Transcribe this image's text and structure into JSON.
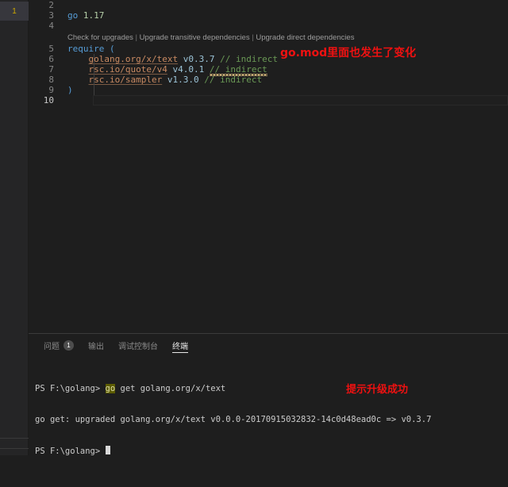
{
  "activity_bar": {
    "marker_count": "1"
  },
  "editor": {
    "lines": [
      {
        "number": "2",
        "type": "code",
        "tokens": []
      },
      {
        "number": "3",
        "type": "code",
        "tokens": [
          {
            "t": "kw",
            "v": "go"
          },
          {
            "t": "plain",
            "v": " "
          },
          {
            "t": "num",
            "v": "1.17"
          }
        ]
      },
      {
        "number": "4",
        "type": "code",
        "tokens": []
      },
      {
        "number": "",
        "type": "codelens",
        "links": [
          "Check for upgrades",
          "Upgrade transitive dependencies",
          "Upgrade direct dependencies"
        ],
        "separator": " | "
      },
      {
        "number": "5",
        "type": "code",
        "tokens": [
          {
            "t": "kw",
            "v": "require"
          },
          {
            "t": "plain",
            "v": " "
          },
          {
            "t": "punct",
            "v": "("
          }
        ]
      },
      {
        "number": "6",
        "type": "code",
        "tokens": [
          {
            "t": "plain",
            "v": "    "
          },
          {
            "t": "path",
            "v": "golang.org/x/text"
          },
          {
            "t": "plain",
            "v": " "
          },
          {
            "t": "ver",
            "v": "v0.3.7"
          },
          {
            "t": "plain",
            "v": " "
          },
          {
            "t": "cmt",
            "v": "// indirect"
          }
        ]
      },
      {
        "number": "7",
        "type": "code",
        "tokens": [
          {
            "t": "plain",
            "v": "    "
          },
          {
            "t": "path",
            "v": "rsc.io/quote/v4"
          },
          {
            "t": "plain",
            "v": " "
          },
          {
            "t": "ver",
            "v": "v4.0.1"
          },
          {
            "t": "plain",
            "v": " "
          },
          {
            "t": "cmt squiggle",
            "v": "// indirect"
          }
        ]
      },
      {
        "number": "8",
        "type": "code",
        "tokens": [
          {
            "t": "plain",
            "v": "    "
          },
          {
            "t": "path",
            "v": "rsc.io/sampler"
          },
          {
            "t": "plain",
            "v": " "
          },
          {
            "t": "ver",
            "v": "v1.3.0"
          },
          {
            "t": "plain",
            "v": " "
          },
          {
            "t": "cmt",
            "v": "// indirect"
          }
        ]
      },
      {
        "number": "9",
        "type": "code",
        "tokens": [
          {
            "t": "punct",
            "v": ")"
          }
        ]
      },
      {
        "number": "10",
        "type": "code",
        "active": true,
        "tokens": []
      }
    ],
    "annotation": "go.mod里面也发生了变化",
    "annotation_color": "#ee1111"
  },
  "panel": {
    "tabs": [
      {
        "label": "问题",
        "badge": "1",
        "active": false
      },
      {
        "label": "输出",
        "badge": "",
        "active": false
      },
      {
        "label": "调试控制台",
        "badge": "",
        "active": false
      },
      {
        "label": "终端",
        "badge": "",
        "active": true
      }
    ],
    "terminal": {
      "line1_prompt": "PS F:\\golang> ",
      "line1_highlight": "go",
      "line1_rest": " get golang.org/x/text",
      "line2": "go get: upgraded golang.org/x/text v0.0.0-20170915032832-14c0d48ead0c => v0.3.7",
      "line3_prompt": "PS F:\\golang> "
    },
    "annotation": "提示升级成功",
    "annotation_color": "#ee1111"
  }
}
